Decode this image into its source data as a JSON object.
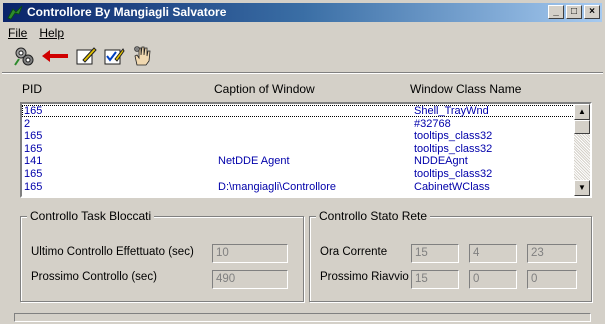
{
  "window": {
    "title": "Controllore By Mangiagli Salvatore"
  },
  "menu": {
    "file": "File",
    "help": "Help"
  },
  "toolbar": {
    "icons": [
      "gears-icon",
      "back-arrow-icon",
      "edit-icon",
      "edit-check-icon",
      "hand-icon"
    ]
  },
  "list": {
    "headers": {
      "pid": "PID",
      "caption": "Caption of Window",
      "class": "Window Class Name"
    },
    "rows": [
      {
        "pid": "165",
        "caption": "",
        "class": "Shell_TrayWnd"
      },
      {
        "pid": "2",
        "caption": "",
        "class": "#32768"
      },
      {
        "pid": "165",
        "caption": "",
        "class": "tooltips_class32"
      },
      {
        "pid": "165",
        "caption": "",
        "class": "tooltips_class32"
      },
      {
        "pid": "141",
        "caption": "NetDDE Agent",
        "class": "NDDEAgnt"
      },
      {
        "pid": "165",
        "caption": "",
        "class": "tooltips_class32"
      },
      {
        "pid": "165",
        "caption": "D:\\mangiagli\\Controllore",
        "class": "CabinetWClass"
      }
    ]
  },
  "task_group": {
    "title": "Controllo Task Bloccati",
    "last_label": "Ultimo Controllo Effettuato (sec)",
    "last_value": "10",
    "next_label": "Prossimo Controllo (sec)",
    "next_value": "490"
  },
  "net_group": {
    "title": "Controllo Stato Rete",
    "now_label": "Ora Corrente",
    "now_h": "15",
    "now_m": "4",
    "now_s": "23",
    "restart_label": "Prossimo Riavvio",
    "restart_h": "15",
    "restart_m": "0",
    "restart_s": "0"
  }
}
